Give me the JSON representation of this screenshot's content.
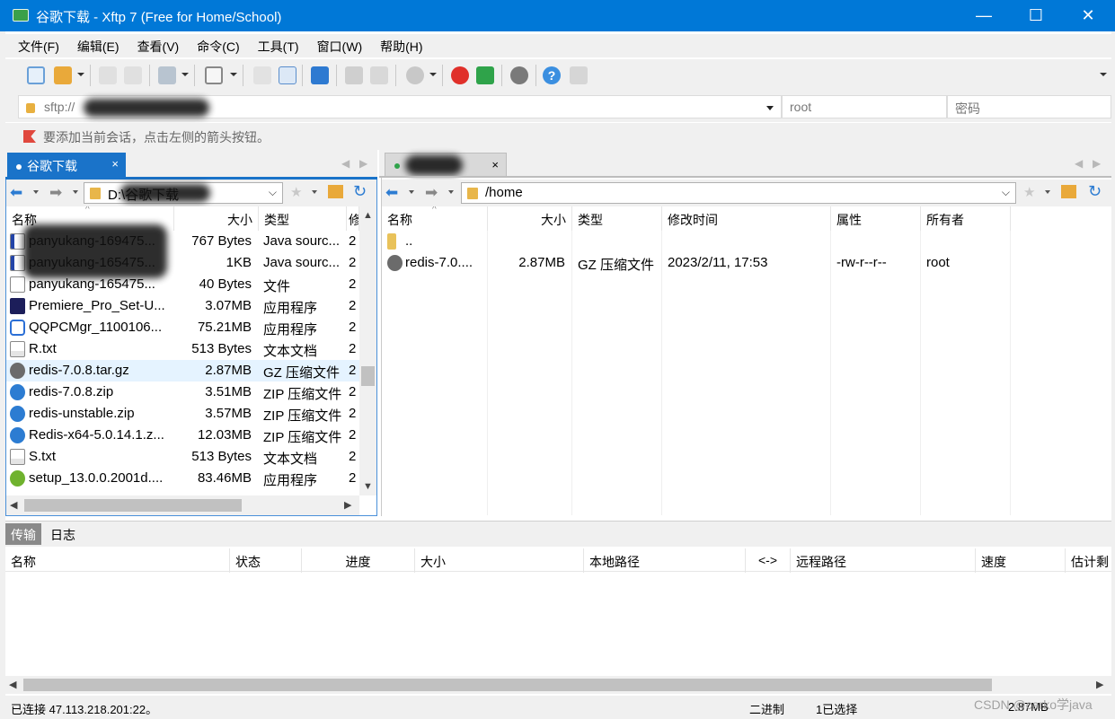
{
  "window": {
    "title": "谷歌下载 - Xftp 7 (Free for Home/School)",
    "minimize": "—",
    "maximize": "☐",
    "close": "✕"
  },
  "menu": [
    "文件(F)",
    "编辑(E)",
    "查看(V)",
    "命令(C)",
    "工具(T)",
    "窗口(W)",
    "帮助(H)"
  ],
  "address": {
    "host_value": "sftp://",
    "user_placeholder": "root",
    "password_placeholder": "密码"
  },
  "hint": "要添加当前会话，点击左侧的箭头按钮。",
  "local": {
    "tab_label": "谷歌下载",
    "tab_close": "×",
    "path": "D:\\谷歌下载",
    "headers": [
      "名称",
      "大小",
      "类型",
      "修"
    ],
    "files": [
      {
        "name": "panyukang-169475...",
        "size": "767 Bytes",
        "type": "Java sourc...",
        "mod": "2",
        "icon": "java-file-icon"
      },
      {
        "name": "panyukang-165475...",
        "size": "1KB",
        "type": "Java sourc...",
        "mod": "2",
        "icon": "java-file-icon"
      },
      {
        "name": "panyukang-165475...",
        "size": "40 Bytes",
        "type": "文件",
        "mod": "2",
        "icon": "blank-file-icon"
      },
      {
        "name": "Premiere_Pro_Set-U...",
        "size": "3.07MB",
        "type": "应用程序",
        "mod": "2",
        "icon": "premiere-icon"
      },
      {
        "name": "QQPCMgr_1100106...",
        "size": "75.21MB",
        "type": "应用程序",
        "mod": "2",
        "icon": "qqpcmgr-icon"
      },
      {
        "name": "R.txt",
        "size": "513 Bytes",
        "type": "文本文档",
        "mod": "2",
        "icon": "text-file-icon"
      },
      {
        "name": "redis-7.0.8.tar.gz",
        "size": "2.87MB",
        "type": "GZ 压缩文件",
        "mod": "2",
        "icon": "gz-archive-icon"
      },
      {
        "name": "redis-7.0.8.zip",
        "size": "3.51MB",
        "type": "ZIP 压缩文件",
        "mod": "2",
        "icon": "zip-archive-icon"
      },
      {
        "name": "redis-unstable.zip",
        "size": "3.57MB",
        "type": "ZIP 压缩文件",
        "mod": "2",
        "icon": "zip-archive-icon"
      },
      {
        "name": "Redis-x64-5.0.14.1.z...",
        "size": "12.03MB",
        "type": "ZIP 压缩文件",
        "mod": "2",
        "icon": "zip-archive-icon"
      },
      {
        "name": "S.txt",
        "size": "513 Bytes",
        "type": "文本文档",
        "mod": "2",
        "icon": "text-file-icon"
      },
      {
        "name": "setup_13.0.0.2001d....",
        "size": "83.46MB",
        "type": "应用程序",
        "mod": "2",
        "icon": "setup-app-icon"
      }
    ],
    "selected_index": 6
  },
  "remote": {
    "tab_close": "×",
    "path": "/home",
    "headers": [
      "名称",
      "大小",
      "类型",
      "修改时间",
      "属性",
      "所有者"
    ],
    "files": [
      {
        "name": "..",
        "size": "",
        "type": "",
        "modified": "",
        "perm": "",
        "owner": "",
        "icon": "folder-up-icon"
      },
      {
        "name": "redis-7.0....",
        "size": "2.87MB",
        "type": "GZ 压缩文件",
        "modified": "2023/2/11, 17:53",
        "perm": "-rw-r--r--",
        "owner": "root",
        "icon": "gz-archive-icon"
      }
    ]
  },
  "transfer": {
    "tabs": [
      "传输",
      "日志"
    ],
    "headers": [
      "名称",
      "状态",
      "进度",
      "大小",
      "本地路径",
      "<->",
      "远程路径",
      "速度",
      "估计剩"
    ]
  },
  "status": {
    "connected": "已连接 47.113.218.201:22。",
    "mode": "二进制",
    "selected": "1已选择",
    "size": "2.87MB",
    "watermark": "CSDN @carko学java"
  }
}
